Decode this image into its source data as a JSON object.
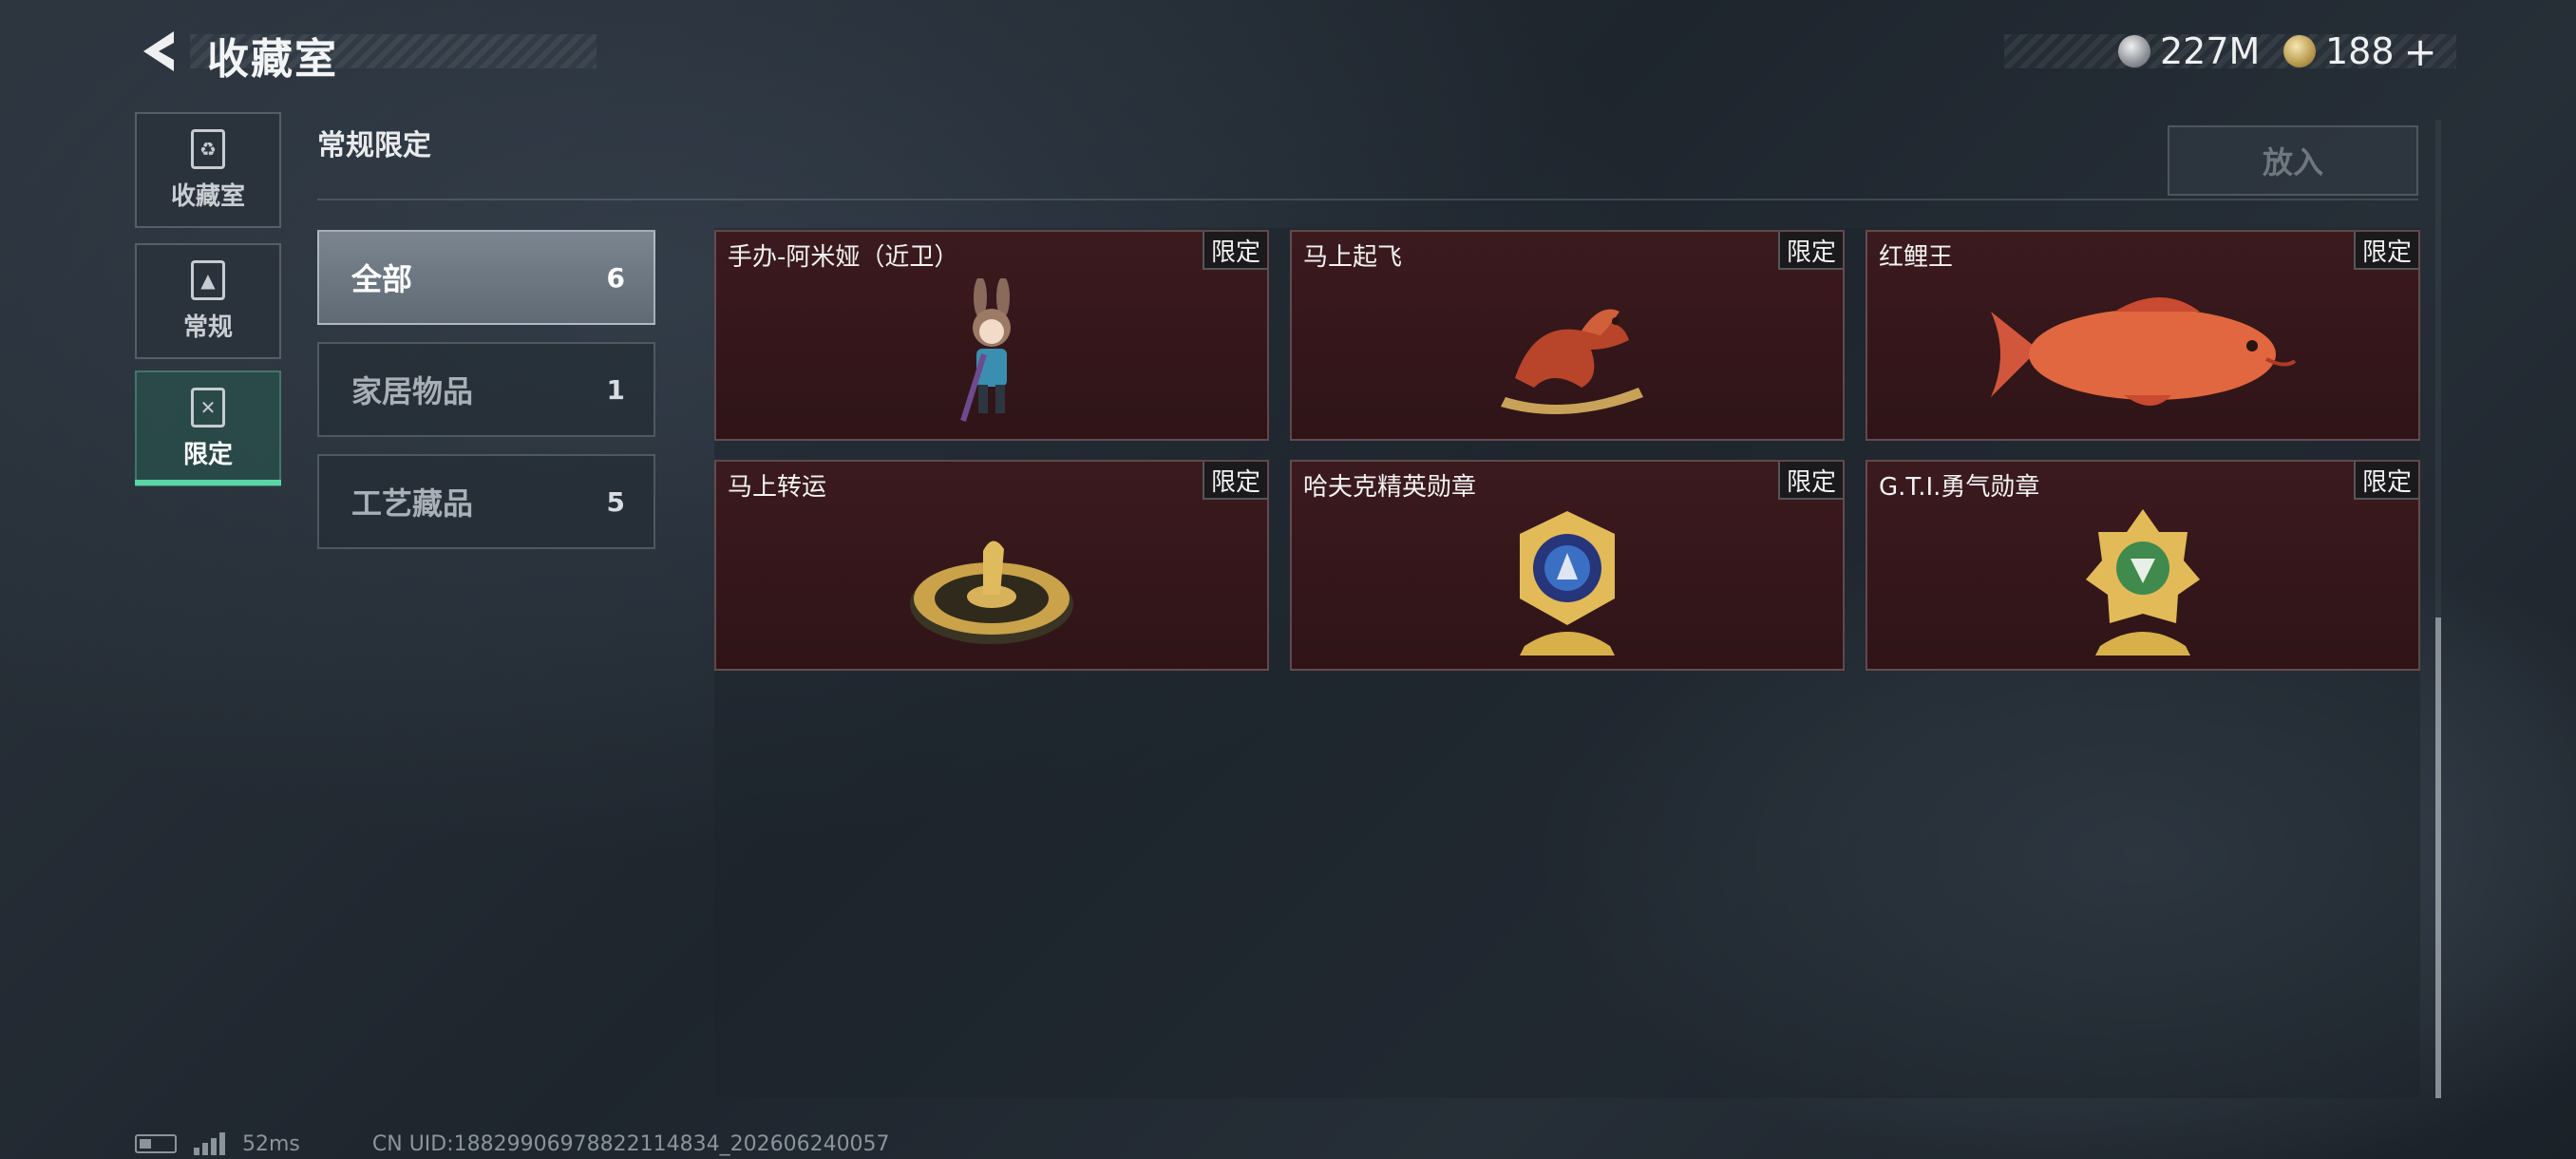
{
  "header": {
    "title": "收藏室",
    "back_icon": "back-arrow-icon",
    "currencies": [
      {
        "icon": "silver-coin-icon",
        "value": "227M"
      },
      {
        "icon": "gold-coin-icon",
        "value": "188"
      }
    ],
    "add_label": "+"
  },
  "sidebar": {
    "items": [
      {
        "label": "收藏室",
        "icon": "collection-icon"
      },
      {
        "label": "常规",
        "icon": "regular-icon"
      },
      {
        "label": "限定",
        "icon": "limited-icon"
      }
    ],
    "active_index": 2
  },
  "section": {
    "title": "常规限定",
    "place_button": "放入"
  },
  "categories": [
    {
      "name": "全部",
      "count": "6"
    },
    {
      "name": "家居物品",
      "count": "1"
    },
    {
      "name": "工艺藏品",
      "count": "5"
    }
  ],
  "items": [
    {
      "name": "手办-阿米娅（近卫）",
      "tag": "限定",
      "icon": "figure-icon"
    },
    {
      "name": "马上起飞",
      "tag": "限定",
      "icon": "horse-sculpture-icon"
    },
    {
      "name": "红鲤王",
      "tag": "限定",
      "icon": "carp-icon"
    },
    {
      "name": "马上转运",
      "tag": "限定",
      "icon": "horse-dial-icon"
    },
    {
      "name": "哈夫克精英勋章",
      "tag": "限定",
      "icon": "blue-medal-icon"
    },
    {
      "name": "G.T.I.勇气勋章",
      "tag": "限定",
      "icon": "green-medal-icon"
    }
  ],
  "footer": {
    "ping": "52ms",
    "uid": "CN UID:18829906978822114834_202606240057"
  },
  "colors": {
    "accent": "#58d6a6",
    "card_bg": "#3b1a1e",
    "background": "#232a32"
  }
}
